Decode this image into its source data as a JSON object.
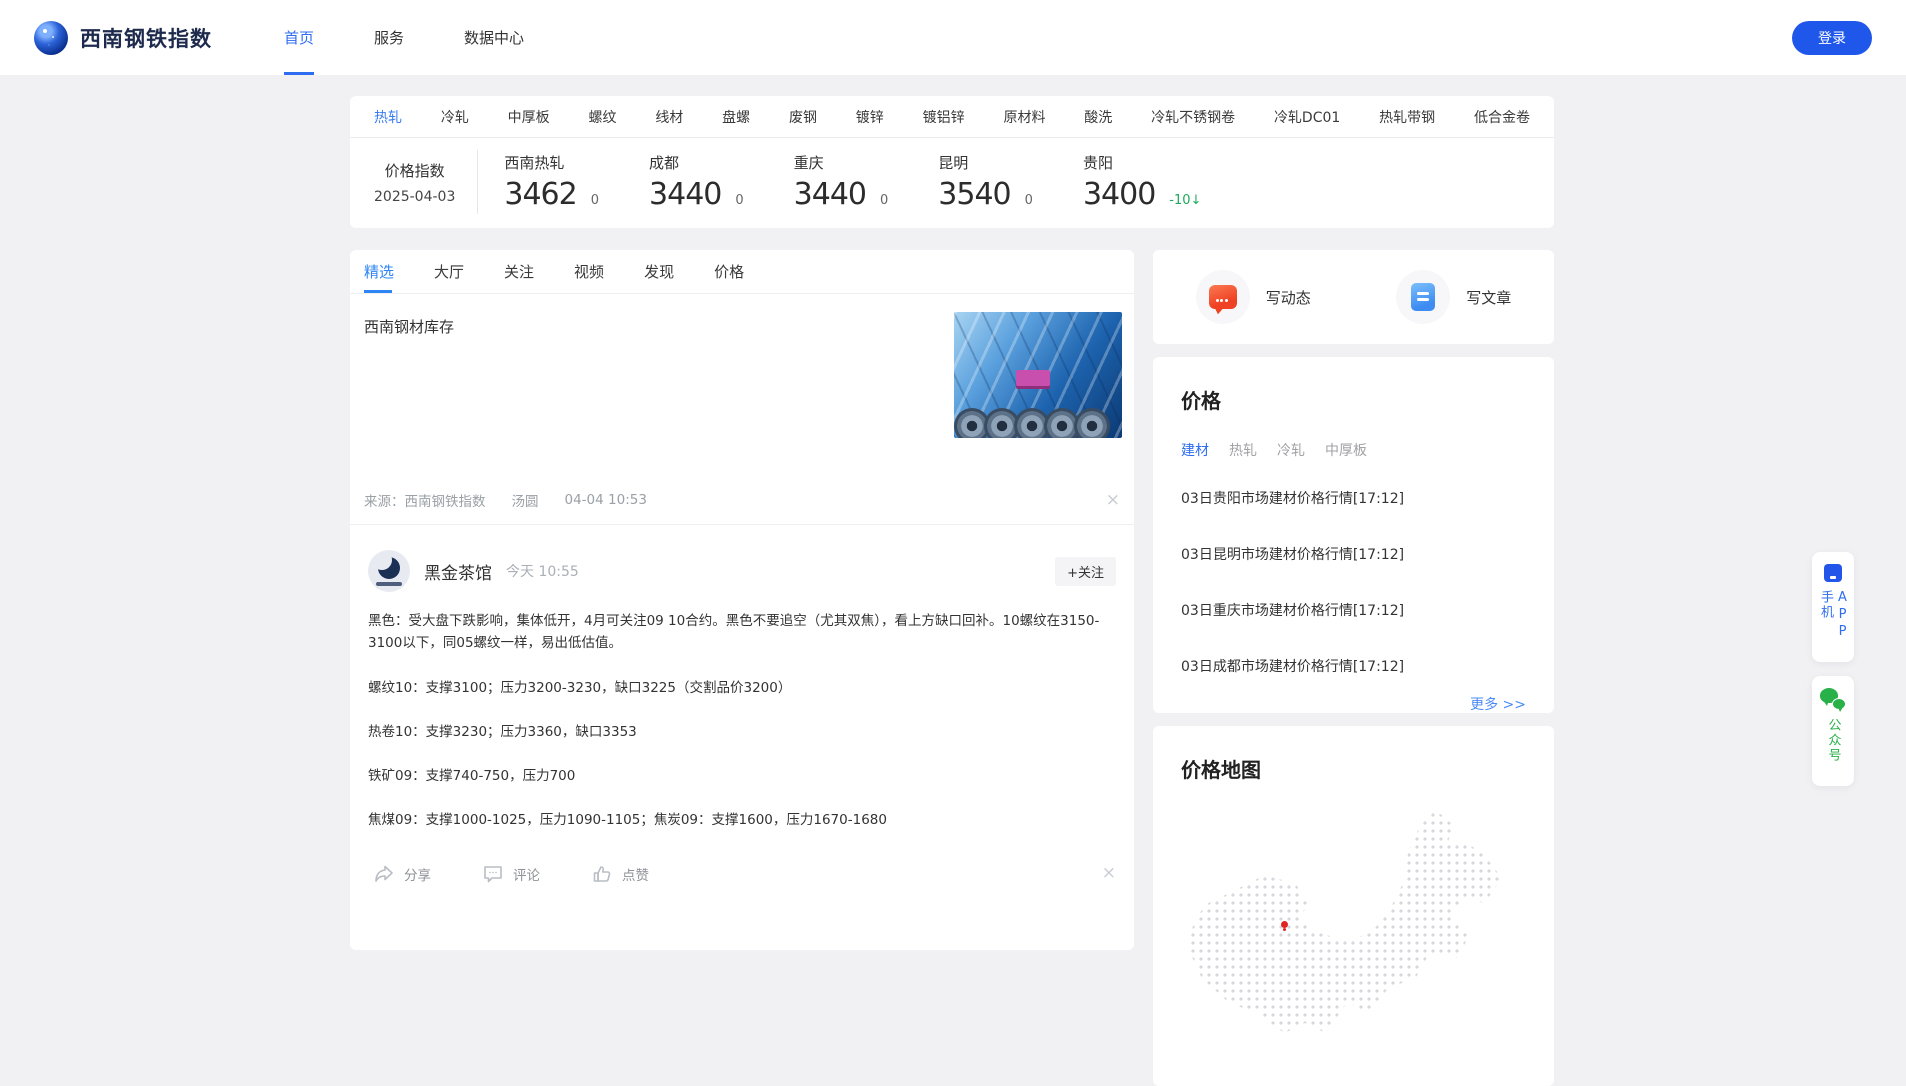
{
  "navbar": {
    "brand": "西南钢铁指数",
    "items": [
      {
        "label": "首页"
      },
      {
        "label": "服务"
      },
      {
        "label": "数据中心"
      }
    ],
    "login_label": "登录"
  },
  "category_tabs": [
    "热轧",
    "冷轧",
    "中厚板",
    "螺纹",
    "线材",
    "盘螺",
    "废钢",
    "镀锌",
    "镀铝锌",
    "原材料",
    "酸洗",
    "冷轧不锈钢卷",
    "冷轧DC01",
    "热轧带钢",
    "低合金卷"
  ],
  "price_index": {
    "label": "价格指数",
    "date": "2025-04-03",
    "quotes": [
      {
        "name": "西南热轧",
        "value": "3462",
        "change": "0"
      },
      {
        "name": "成都",
        "value": "3440",
        "change": "0"
      },
      {
        "name": "重庆",
        "value": "3440",
        "change": "0"
      },
      {
        "name": "昆明",
        "value": "3540",
        "change": "0"
      },
      {
        "name": "贵阳",
        "value": "3400",
        "change": "-10↓"
      }
    ]
  },
  "feed": {
    "tabs": [
      "精选",
      "大厅",
      "关注",
      "视频",
      "发现",
      "价格"
    ],
    "article": {
      "title": "西南钢材库存",
      "source": "来源：西南钢铁指数",
      "author": "汤圆",
      "time": "04-04 10:53",
      "close": "×"
    },
    "post": {
      "author": "黑金茶馆",
      "time": "今天 10:55",
      "follow_label": "+关注",
      "paragraphs": [
        "黑色：受大盘下跌影响，集体低开，4月可关注09 10合约。黑色不要追空（尤其双焦），看上方缺口回补。10螺纹在3150-3100以下，同05螺纹一样，易出低估值。",
        "螺纹10：支撑3100；压力3200-3230，缺口3225（交割品价3200）",
        "热卷10：支撑3230；压力3360，缺口3353",
        "铁矿09：支撑740-750，压力700",
        "焦煤09：支撑1000-1025，压力1090-1105；焦炭09：支撑1600，压力1670-1680"
      ],
      "actions": {
        "share": "分享",
        "comment": "评论",
        "like": "点赞",
        "close": "×"
      }
    }
  },
  "sidebar": {
    "compose": {
      "moment_label": "写动态",
      "article_label": "写文章"
    },
    "price_card": {
      "title": "价格",
      "tabs": [
        "建材",
        "热轧",
        "冷轧",
        "中厚板"
      ],
      "items": [
        "03日贵阳市场建材价格行情[17:12]",
        "03日昆明市场建材价格行情[17:12]",
        "03日重庆市场建材价格行情[17:12]",
        "03日成都市场建材价格行情[17:12]"
      ],
      "more_label": "更多 >>"
    },
    "map_card": {
      "title": "价格地图"
    }
  },
  "floating": {
    "app_label": "手机APP",
    "wechat_label": "公众号"
  },
  "colors": {
    "accent_blue": "#2e6cf0",
    "login_blue": "#2057eb",
    "down_green": "#1fa85c",
    "moment_red": "#ef4123",
    "article_blue": "#3e8cf2"
  }
}
